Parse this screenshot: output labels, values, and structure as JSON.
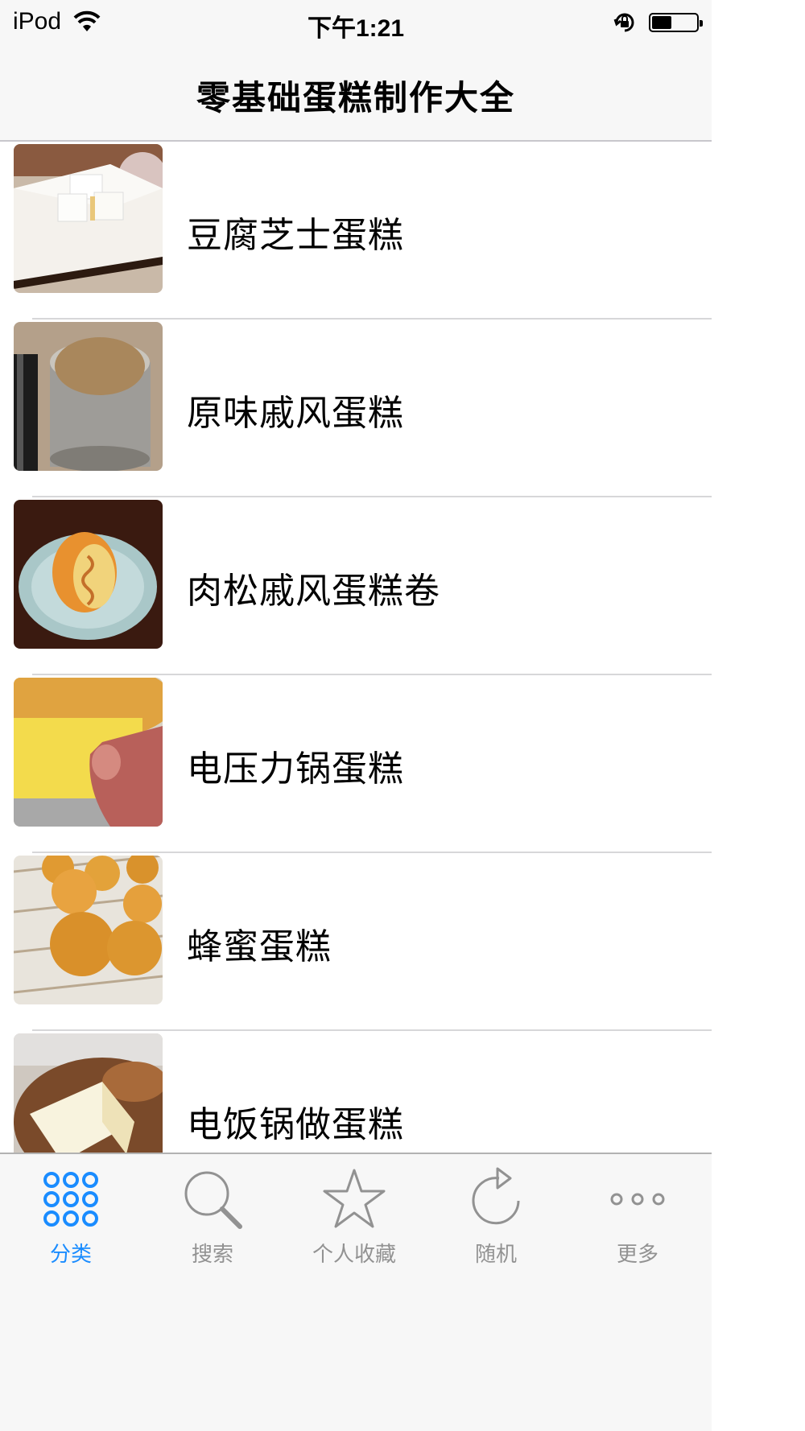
{
  "status_bar": {
    "carrier": "iPod",
    "time": "下午1:21",
    "icons": [
      "wifi-icon",
      "orientation-lock-icon",
      "battery-icon"
    ],
    "battery_level": 0.45
  },
  "nav": {
    "title": "零基础蛋糕制作大全"
  },
  "list": {
    "items": [
      {
        "label": "豆腐芝士蛋糕",
        "thumb": "tofu-cheesecake-photo"
      },
      {
        "label": "原味戚风蛋糕",
        "thumb": "chiffon-cake-photo"
      },
      {
        "label": "肉松戚风蛋糕卷",
        "thumb": "pork-floss-roll-photo"
      },
      {
        "label": "电压力锅蛋糕",
        "thumb": "pressure-cooker-cake-photo"
      },
      {
        "label": "蜂蜜蛋糕",
        "thumb": "honey-cupcakes-photo"
      },
      {
        "label": "电饭锅做蛋糕",
        "thumb": "rice-cooker-cake-photo"
      }
    ]
  },
  "tabbar": {
    "active_color": "#1a8cff",
    "inactive_color": "#929292",
    "tabs": [
      {
        "label": "分类",
        "icon": "grid-dots-icon",
        "active": true
      },
      {
        "label": "搜索",
        "icon": "search-icon",
        "active": false
      },
      {
        "label": "个人收藏",
        "icon": "star-icon",
        "active": false
      },
      {
        "label": "随机",
        "icon": "refresh-icon",
        "active": false
      },
      {
        "label": "更多",
        "icon": "more-dots-icon",
        "active": false
      }
    ]
  }
}
